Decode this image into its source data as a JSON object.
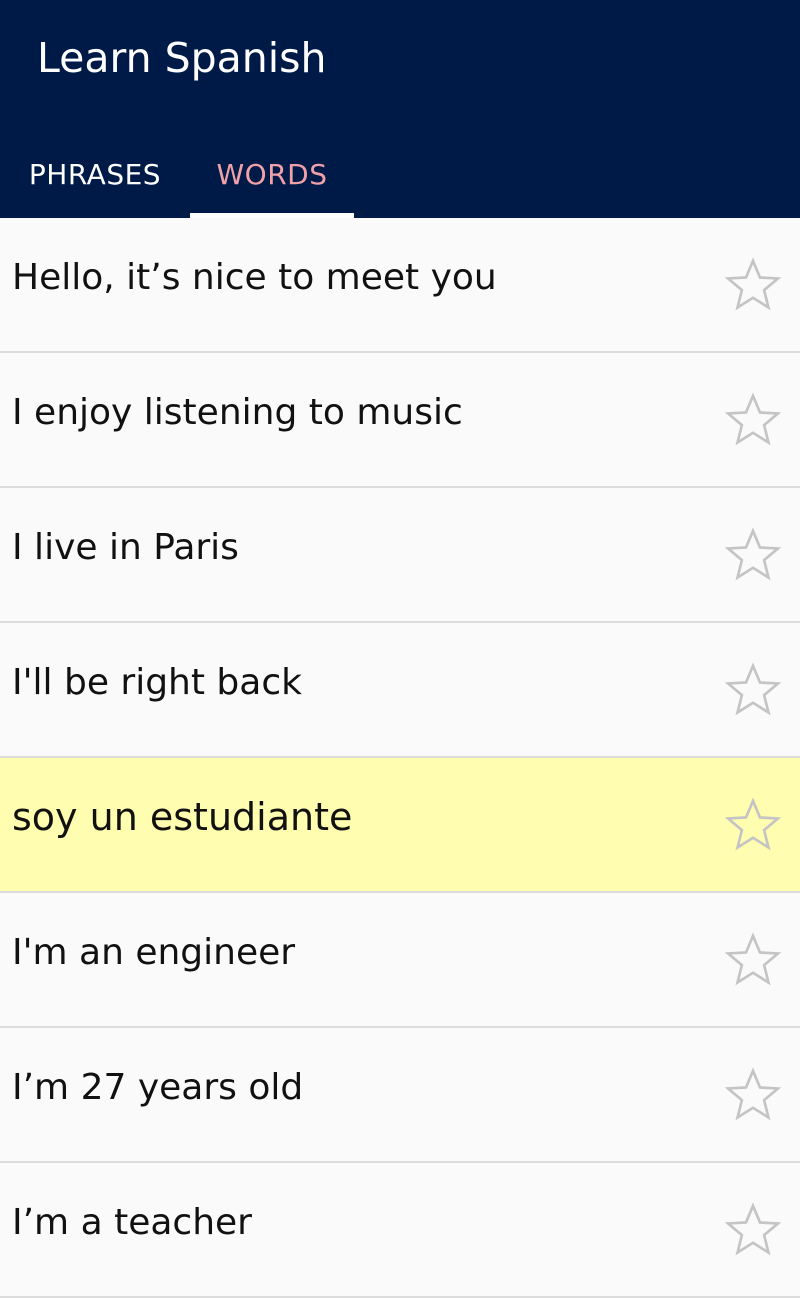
{
  "app": {
    "title": "Learn Spanish",
    "colors": {
      "appbar": "#001a48",
      "active_tab": "#f0a0a8",
      "highlight_row": "#fffdb0"
    }
  },
  "tabs": [
    {
      "label": "PHRASES",
      "active": false
    },
    {
      "label": "WORDS",
      "active": true
    }
  ],
  "list": {
    "items": [
      {
        "text": "Hello, it’s nice to meet you",
        "starred": false,
        "highlighted": false,
        "icon": "star-outline-icon"
      },
      {
        "text": "I enjoy listening to music",
        "starred": false,
        "highlighted": false,
        "icon": "star-outline-icon"
      },
      {
        "text": "I live in Paris",
        "starred": false,
        "highlighted": false,
        "icon": "star-outline-icon"
      },
      {
        "text": "I'll be right back",
        "starred": false,
        "highlighted": false,
        "icon": "star-outline-icon"
      },
      {
        "text": "soy un estudiante",
        "starred": false,
        "highlighted": true,
        "icon": "star-outline-icon"
      },
      {
        "text": "I'm an engineer",
        "starred": false,
        "highlighted": false,
        "icon": "star-outline-icon"
      },
      {
        "text": "I’m 27 years old",
        "starred": false,
        "highlighted": false,
        "icon": "star-outline-icon"
      },
      {
        "text": "I’m a teacher",
        "starred": false,
        "highlighted": false,
        "icon": "star-outline-icon"
      }
    ]
  }
}
